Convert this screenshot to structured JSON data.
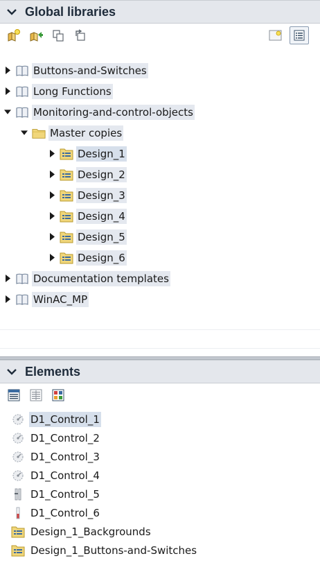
{
  "libraries": {
    "title": "Global libraries",
    "toolbar": [
      "new-library-icon",
      "open-library-icon",
      "copy-icon",
      "update-icon",
      "new-type-icon",
      "details-view-icon"
    ],
    "tree": [
      {
        "label": "Buttons-and-Switches",
        "level": 0,
        "icon": "book-icon",
        "expanded": false,
        "highlight": true
      },
      {
        "label": "Long Functions",
        "level": 0,
        "icon": "book-icon",
        "expanded": false,
        "highlight": true
      },
      {
        "label": "Monitoring-and-control-objects",
        "level": 0,
        "icon": "book-icon",
        "expanded": true,
        "highlight": true
      },
      {
        "label": "Master copies",
        "level": 1,
        "icon": "folder-icon",
        "expanded": true,
        "highlight": true
      },
      {
        "label": "Design_1",
        "level": 2,
        "icon": "design-folder-icon",
        "expanded": false,
        "selected": true
      },
      {
        "label": "Design_2",
        "level": 2,
        "icon": "design-folder-icon",
        "expanded": false,
        "highlight": true
      },
      {
        "label": "Design_3",
        "level": 2,
        "icon": "design-folder-icon",
        "expanded": false,
        "highlight": true
      },
      {
        "label": "Design_4",
        "level": 2,
        "icon": "design-folder-icon",
        "expanded": false,
        "highlight": true
      },
      {
        "label": "Design_5",
        "level": 2,
        "icon": "design-folder-icon",
        "expanded": false,
        "highlight": true
      },
      {
        "label": "Design_6",
        "level": 2,
        "icon": "design-folder-icon",
        "expanded": false,
        "highlight": true
      },
      {
        "label": "Documentation templates",
        "level": 0,
        "icon": "book-icon",
        "expanded": false,
        "highlight": true
      },
      {
        "label": "WinAC_MP",
        "level": 0,
        "icon": "book-icon",
        "expanded": false,
        "highlight": true
      }
    ]
  },
  "elements": {
    "title": "Elements",
    "toolbar": [
      "details-view-icon",
      "list-view-icon",
      "overview-icon"
    ],
    "items": [
      {
        "label": "D1_Control_1",
        "icon": "control-icon",
        "selected": true
      },
      {
        "label": "D1_Control_2",
        "icon": "control-icon"
      },
      {
        "label": "D1_Control_3",
        "icon": "control-icon"
      },
      {
        "label": "D1_Control_4",
        "icon": "control-icon"
      },
      {
        "label": "D1_Control_5",
        "icon": "slider-control-icon"
      },
      {
        "label": "D1_Control_6",
        "icon": "bar-control-icon"
      },
      {
        "label": "Design_1_Backgrounds",
        "icon": "design-folder-icon"
      },
      {
        "label": "Design_1_Buttons-and-Switches",
        "icon": "design-folder-icon"
      }
    ]
  }
}
